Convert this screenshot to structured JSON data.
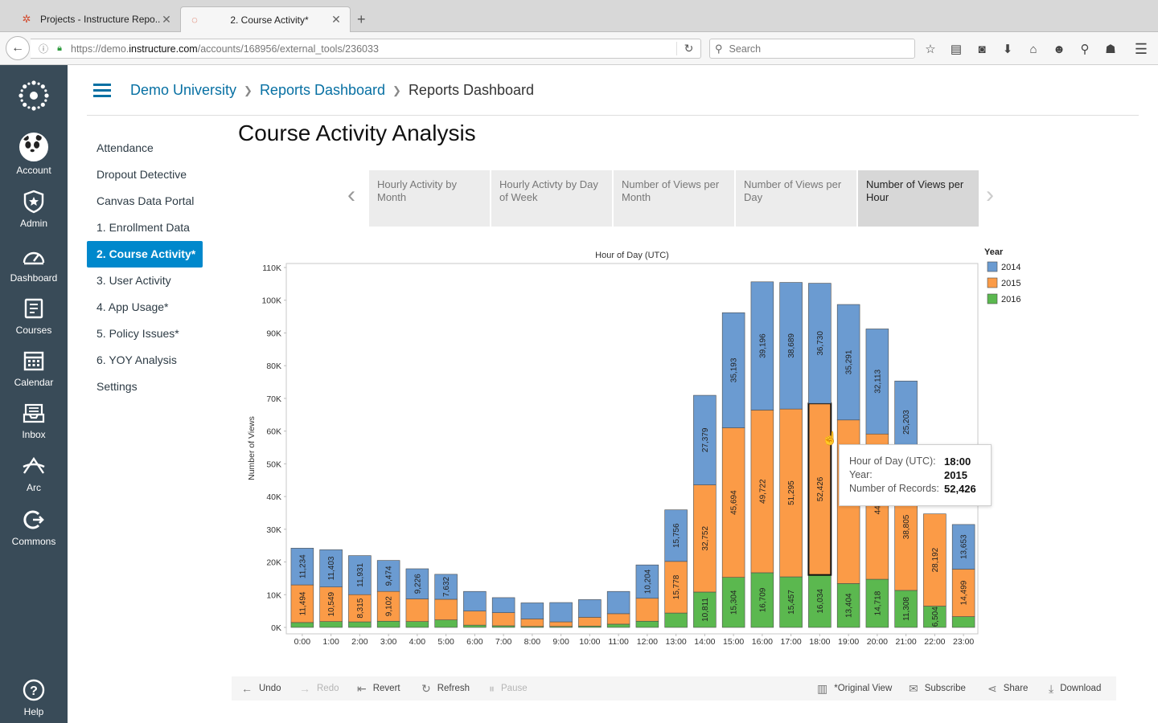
{
  "browser": {
    "tabs": [
      {
        "title": "Projects - Instructure Repo..."
      },
      {
        "title": "2. Course Activity*"
      }
    ],
    "url_prefix": "https://demo.",
    "url_host": "instructure.com",
    "url_path": "/accounts/168956/external_tools/236033",
    "search_placeholder": "Search"
  },
  "global_nav": [
    {
      "label": "Account",
      "icon": "avatar"
    },
    {
      "label": "Admin",
      "icon": "admin-shield-icon"
    },
    {
      "label": "Dashboard",
      "icon": "dashboard-gauge-icon"
    },
    {
      "label": "Courses",
      "icon": "courses-book-icon"
    },
    {
      "label": "Calendar",
      "icon": "calendar-icon"
    },
    {
      "label": "Inbox",
      "icon": "inbox-icon"
    },
    {
      "label": "Arc",
      "icon": "arc-icon"
    },
    {
      "label": "Commons",
      "icon": "commons-icon"
    },
    {
      "label": "Help",
      "icon": "help-icon"
    }
  ],
  "breadcrumbs": [
    "Demo University",
    "Reports Dashboard",
    "Reports Dashboard"
  ],
  "course_nav": [
    "Attendance",
    "Dropout Detective",
    "Canvas Data Portal",
    "1. Enrollment Data",
    "2. Course Activity*",
    "3. User Activity",
    "4. App Usage*",
    "5. Policy Issues*",
    "6. YOY Analysis",
    "Settings"
  ],
  "course_nav_active": "2. Course Activity*",
  "page_title": "Course Activity Analysis",
  "story_tabs": [
    "Hourly Activity by Month",
    "Hourly Activty by Day of Week",
    "Number of Views per Month",
    "Number of Views per Day",
    "Number of Views per Hour"
  ],
  "story_tab_active": "Number of Views per Hour",
  "chart_data": {
    "type": "bar",
    "stacked": true,
    "title": "Hour of Day (UTC)",
    "xlabel": "",
    "ylabel": "Number of Views",
    "ylim": [
      0,
      110000
    ],
    "yticks": [
      "0K",
      "10K",
      "20K",
      "30K",
      "40K",
      "50K",
      "60K",
      "70K",
      "80K",
      "90K",
      "100K",
      "110K"
    ],
    "legend_title": "Year",
    "legend_position": "right",
    "categories": [
      "0:00",
      "1:00",
      "2:00",
      "3:00",
      "4:00",
      "5:00",
      "6:00",
      "7:00",
      "8:00",
      "9:00",
      "10:00",
      "11:00",
      "12:00",
      "13:00",
      "14:00",
      "15:00",
      "16:00",
      "17:00",
      "18:00",
      "19:00",
      "20:00",
      "21:00",
      "22:00",
      "23:00"
    ],
    "series": [
      {
        "name": "2016",
        "color": "#5bb84f",
        "values": [
          1500,
          1800,
          1700,
          1900,
          1800,
          2300,
          700,
          500,
          300,
          300,
          400,
          1000,
          1900,
          4400,
          10811,
          15304,
          16709,
          15457,
          16034,
          13404,
          14718,
          11308,
          6504,
          3300
        ],
        "labels": [
          "",
          "",
          "",
          "",
          "",
          "",
          "",
          "",
          "",
          "",
          "",
          "",
          "",
          "",
          "10,811",
          "15,304",
          "16,709",
          "15,457",
          "16,034",
          "13,404",
          "14,718",
          "11,308",
          "6,504",
          ""
        ]
      },
      {
        "name": "2015",
        "color": "#fb9b47",
        "values": [
          11494,
          10549,
          8315,
          9102,
          6900,
          6300,
          4300,
          4000,
          2300,
          1400,
          2700,
          3200,
          7000,
          15778,
          32752,
          45694,
          49722,
          51295,
          52426,
          50000,
          44400,
          38805,
          28192,
          14499
        ],
        "labels": [
          "11,494",
          "10,549",
          "8,315",
          "9,102",
          "",
          "",
          "",
          "",
          "",
          "",
          "",
          "",
          "",
          "15,778",
          "32,752",
          "45,694",
          "49,722",
          "51,295",
          "52,426",
          "50",
          "44,4",
          "38,805",
          "28,192",
          "14,499"
        ]
      },
      {
        "name": "2014",
        "color": "#6b9bd1",
        "values": [
          11234,
          11403,
          11931,
          9474,
          9226,
          7632,
          6000,
          4600,
          4900,
          5900,
          5400,
          6800,
          10204,
          15756,
          27379,
          35193,
          39196,
          38689,
          36730,
          35291,
          32113,
          25203,
          0,
          13653
        ],
        "labels": [
          "11,234",
          "11,403",
          "11,931",
          "9,474",
          "9,226",
          "7,632",
          "",
          "",
          "",
          "",
          "",
          "",
          "10,204",
          "15,756",
          "27,379",
          "35,193",
          "39,196",
          "38,689",
          "36,730",
          "35,291",
          "32,113",
          "25,203",
          "",
          "13,653"
        ]
      }
    ]
  },
  "tooltip": {
    "rows": [
      {
        "k": "Hour of Day (UTC):",
        "v": "18:00"
      },
      {
        "k": "Year:",
        "v": "2015"
      },
      {
        "k": "Number of Records:",
        "v": "52,426"
      }
    ]
  },
  "toolbar": {
    "undo": "Undo",
    "redo": "Redo",
    "revert": "Revert",
    "refresh": "Refresh",
    "pause": "Pause",
    "original_view": "*Original View",
    "subscribe": "Subscribe",
    "share": "Share",
    "download": "Download"
  }
}
